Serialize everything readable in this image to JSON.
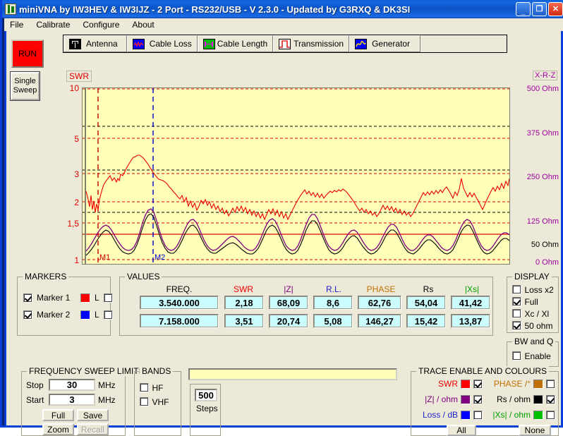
{
  "window": {
    "title": "miniVNA by IW3HEV & IW3IJZ - 2 Port - RS232/USB - V 2.3.0 - Updated by G3RXQ & DK3SI",
    "minimize": "_",
    "maximize": "❐",
    "close": "✕"
  },
  "menu": {
    "items": [
      "File",
      "Calibrate",
      "Configure",
      "About"
    ]
  },
  "toolbar": {
    "run_label": "RUN",
    "sweep_label": "Single\nSweep",
    "sweep_line1": "Single",
    "sweep_line2": "Sweep"
  },
  "tabs": [
    {
      "label": "Antenna",
      "icon": "antenna-icon",
      "active": true
    },
    {
      "label": "Cable Loss",
      "icon": "cable-loss-icon",
      "active": false
    },
    {
      "label": "Cable Length",
      "icon": "cable-length-icon",
      "active": false
    },
    {
      "label": "Transmission",
      "icon": "transmission-icon",
      "active": false
    },
    {
      "label": "Generator",
      "icon": "generator-icon",
      "active": false
    }
  ],
  "chart_data": {
    "type": "line",
    "title": "",
    "xlabel": "",
    "ylabel": "SWR",
    "y_left_label": "SWR",
    "y_right_label": "X-R-Z",
    "left_axis_ticks": [
      "10",
      "5",
      "3",
      "2",
      "1,5",
      "1"
    ],
    "left_axis_values": [
      10,
      5,
      3,
      2,
      1.5,
      1
    ],
    "right_axis_ticks": [
      "500 Ohm",
      "375 Ohm",
      "250 Ohm",
      "125 Ohm",
      "50 Ohm",
      "0 Ohm"
    ],
    "right_axis_values": [
      500,
      375,
      250,
      125,
      50,
      0
    ],
    "xlim": [
      3,
      30
    ],
    "x_unit": "MHz",
    "grid": true,
    "legend": "none",
    "markers": [
      {
        "name": "M1",
        "freq_mhz": 3.54,
        "color": "#cc0000"
      },
      {
        "name": "M2",
        "freq_mhz": 7.158,
        "color": "#0000cc"
      }
    ],
    "series": [
      {
        "name": "|Z| / ohm",
        "color": "#800080",
        "axis": "right"
      },
      {
        "name": "Rs / ohm",
        "color": "#000000",
        "axis": "right"
      },
      {
        "name": "SWR",
        "color": "#ee0000",
        "axis": "left"
      }
    ],
    "notes": "SWR trace (red) rises from ~2.7 at 3 MHz, peaks ~4.3 near 9 MHz, noisy 2-3 band across 12-30 MHz. |Z| (purple) and Rs (black) show repeating resonance humps peaking 1.5-2.2 SWR-equivalent."
  },
  "markers_panel": {
    "caption": "MARKERS",
    "rows": [
      {
        "label": "Marker 1",
        "enabled": true,
        "color": "#ff0000",
        "l_label": "L",
        "l_enabled": false
      },
      {
        "label": "Marker 2",
        "enabled": true,
        "color": "#0000ff",
        "l_label": "L",
        "l_enabled": false
      }
    ]
  },
  "values_panel": {
    "caption": "VALUES",
    "headers": [
      {
        "text": "FREQ.",
        "color": "#000000"
      },
      {
        "text": "SWR",
        "color": "#ee0000"
      },
      {
        "text": "|Z|",
        "color": "#800080"
      },
      {
        "text": "R.L.",
        "color": "#2222cc"
      },
      {
        "text": "PHASE",
        "color": "#c07000"
      },
      {
        "text": "Rs",
        "color": "#000000"
      },
      {
        "text": "|Xs|",
        "color": "#00a000"
      }
    ],
    "rows": [
      [
        "3.540.000",
        "2,18",
        "68,09",
        "8,6",
        "62,76",
        "54,04",
        "41,42"
      ],
      [
        "7.158.000",
        "3,51",
        "20,74",
        "5,08",
        "146,27",
        "15,42",
        "13,87"
      ]
    ]
  },
  "display_panel": {
    "caption": "DISPLAY",
    "items": [
      {
        "label": "Loss x2",
        "checked": false
      },
      {
        "label": "Full",
        "checked": true
      },
      {
        "label": "Xc / Xl",
        "checked": false
      },
      {
        "label": "50 ohm",
        "checked": true
      }
    ]
  },
  "bwq_panel": {
    "caption": "BW and Q",
    "items": [
      {
        "label": "Enable",
        "checked": false
      }
    ]
  },
  "sweep_panel": {
    "caption": "FREQUENCY SWEEP LIMITS",
    "stop_label": "Stop",
    "stop_value": "30",
    "stop_unit": "MHz",
    "start_label": "Start",
    "start_value": "3",
    "start_unit": "MHz",
    "buttons": [
      {
        "label": "Full",
        "enabled": true
      },
      {
        "label": "Save",
        "enabled": true
      },
      {
        "label": "Zoom",
        "enabled": true
      },
      {
        "label": "Recall",
        "enabled": false
      }
    ]
  },
  "bands_panel": {
    "caption": "BANDS",
    "items": [
      {
        "label": "HF",
        "checked": false
      },
      {
        "label": "VHF",
        "checked": false
      }
    ]
  },
  "steps_panel": {
    "value": "500",
    "label": "Steps"
  },
  "status_bar": {
    "text": ""
  },
  "trace_panel": {
    "caption": "TRACE ENABLE AND COLOURS",
    "items": [
      {
        "label": "SWR",
        "color": "#ff0000",
        "checked": true,
        "label_color": "#ee0000"
      },
      {
        "label": "PHASE /°",
        "color": "#c07000",
        "checked": false,
        "label_color": "#c07000"
      },
      {
        "label": "|Z| / ohm",
        "color": "#800080",
        "checked": true,
        "label_color": "#800080"
      },
      {
        "label": "Rs / ohm",
        "color": "#000000",
        "checked": true,
        "label_color": "#000000"
      },
      {
        "label": "Loss / dB",
        "color": "#0000ff",
        "checked": false,
        "label_color": "#2222cc"
      },
      {
        "label": "|Xs| / ohm",
        "color": "#00c000",
        "checked": false,
        "label_color": "#00a000"
      }
    ],
    "all_label": "All",
    "none_label": "None"
  }
}
